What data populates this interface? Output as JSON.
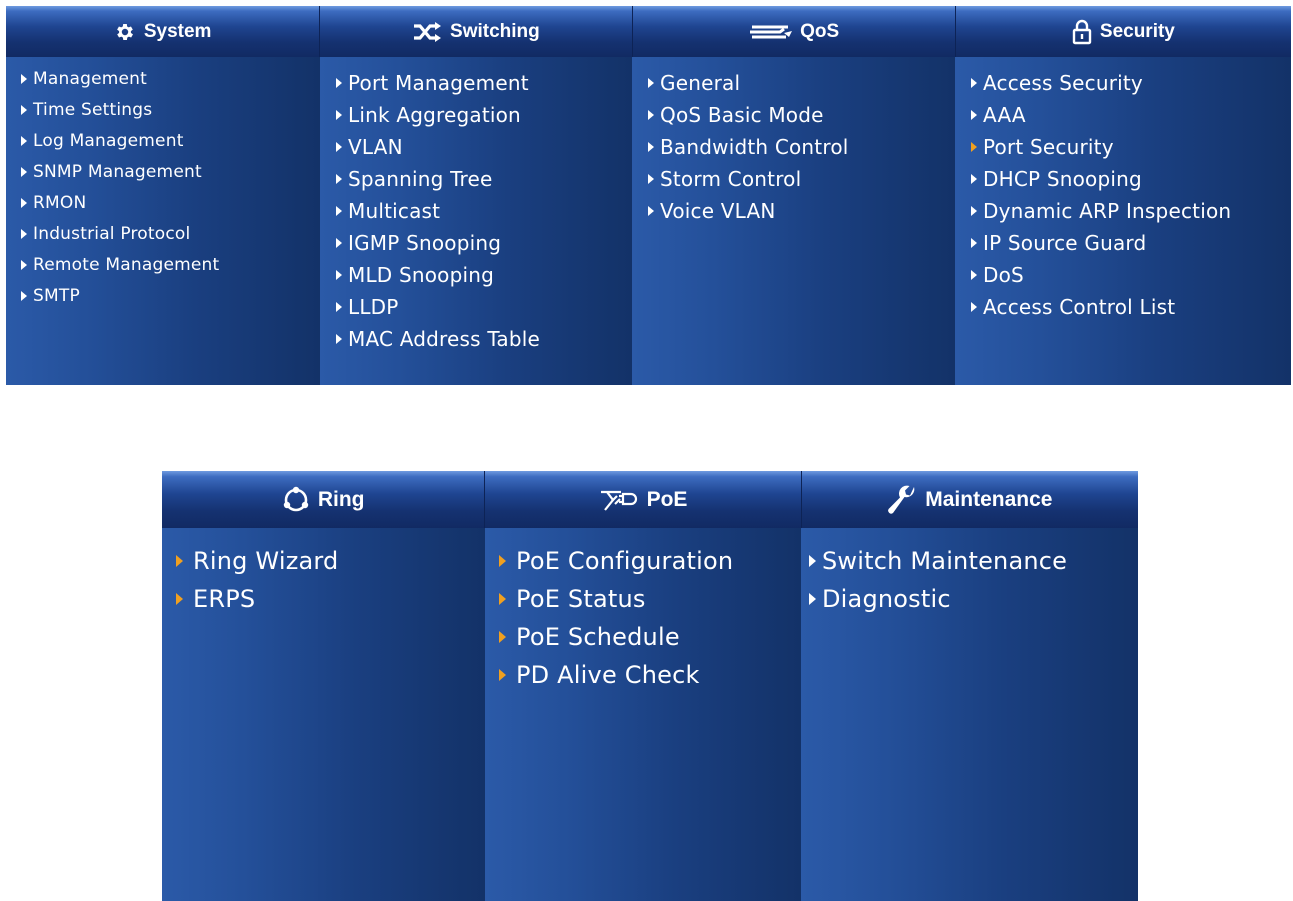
{
  "top_menu": {
    "columns": [
      {
        "key": "system",
        "title": "System",
        "icon": "gear-icon",
        "items": [
          {
            "label": "Management",
            "arrow": "white"
          },
          {
            "label": "Time Settings",
            "arrow": "white"
          },
          {
            "label": "Log Management",
            "arrow": "white"
          },
          {
            "label": "SNMP Management",
            "arrow": "white"
          },
          {
            "label": "RMON",
            "arrow": "white"
          },
          {
            "label": "Industrial Protocol",
            "arrow": "white"
          },
          {
            "label": "Remote Management",
            "arrow": "white"
          },
          {
            "label": "SMTP",
            "arrow": "white"
          }
        ]
      },
      {
        "key": "switching",
        "title": "Switching",
        "icon": "switching-arrows-icon",
        "items": [
          {
            "label": "Port Management",
            "arrow": "white"
          },
          {
            "label": "Link Aggregation",
            "arrow": "white"
          },
          {
            "label": "VLAN",
            "arrow": "white"
          },
          {
            "label": "Spanning Tree",
            "arrow": "white"
          },
          {
            "label": "Multicast",
            "arrow": "white"
          },
          {
            "label": "IGMP Snooping",
            "arrow": "white"
          },
          {
            "label": "MLD Snooping",
            "arrow": "white"
          },
          {
            "label": "LLDP",
            "arrow": "white"
          },
          {
            "label": "MAC Address Table",
            "arrow": "white"
          }
        ]
      },
      {
        "key": "qos",
        "title": "QoS",
        "icon": "qos-lines-icon",
        "items": [
          {
            "label": "General",
            "arrow": "white"
          },
          {
            "label": "QoS Basic Mode",
            "arrow": "white"
          },
          {
            "label": "Bandwidth Control",
            "arrow": "white"
          },
          {
            "label": "Storm Control",
            "arrow": "white"
          },
          {
            "label": "Voice VLAN",
            "arrow": "white"
          }
        ]
      },
      {
        "key": "security",
        "title": "Security",
        "icon": "lock-icon",
        "items": [
          {
            "label": "Access Security",
            "arrow": "white"
          },
          {
            "label": "AAA",
            "arrow": "white"
          },
          {
            "label": "Port Security",
            "arrow": "orange"
          },
          {
            "label": "DHCP Snooping",
            "arrow": "white"
          },
          {
            "label": "Dynamic ARP Inspection",
            "arrow": "white"
          },
          {
            "label": "IP Source Guard",
            "arrow": "white"
          },
          {
            "label": "DoS",
            "arrow": "white"
          },
          {
            "label": "Access Control List",
            "arrow": "white"
          }
        ]
      }
    ]
  },
  "bottom_menu": {
    "columns": [
      {
        "key": "ring",
        "title": "Ring",
        "icon": "ring-icon",
        "items": [
          {
            "label": "Ring Wizard",
            "arrow": "orange"
          },
          {
            "label": "ERPS",
            "arrow": "orange"
          }
        ]
      },
      {
        "key": "poe",
        "title": "PoE",
        "icon": "poe-plug-icon",
        "items": [
          {
            "label": "PoE Configuration",
            "arrow": "orange"
          },
          {
            "label": "PoE Status",
            "arrow": "orange"
          },
          {
            "label": "PoE Schedule",
            "arrow": "orange"
          },
          {
            "label": "PD Alive Check",
            "arrow": "orange"
          }
        ]
      },
      {
        "key": "maintenance",
        "title": "Maintenance",
        "icon": "wrench-icon",
        "items": [
          {
            "label": "Switch Maintenance",
            "arrow": "white"
          },
          {
            "label": "Diagnostic",
            "arrow": "white"
          }
        ]
      }
    ]
  },
  "colors": {
    "header_dark": "#112a63",
    "body_light": "#2b5aa8",
    "body_dark": "#133268",
    "arrow_white": "#ffffff",
    "arrow_orange": "#f0a020",
    "text": "#ffffff"
  }
}
